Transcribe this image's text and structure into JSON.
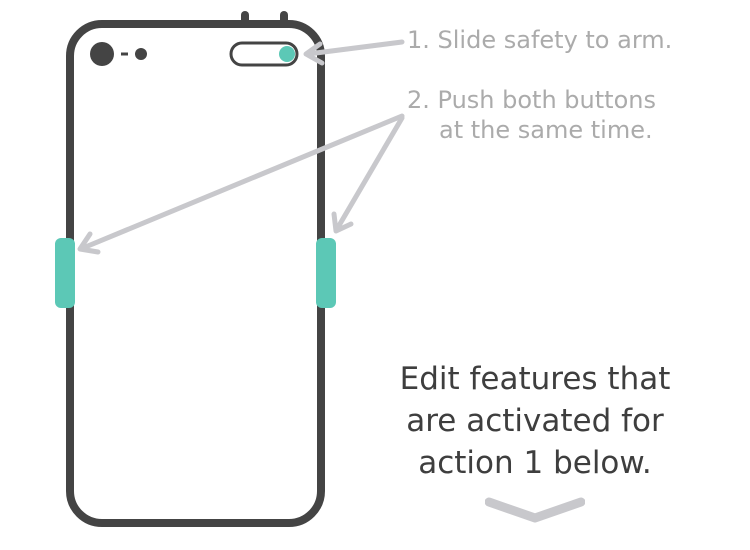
{
  "instructions": {
    "step1": "1. Slide safety to arm.",
    "step2_line1": "2. Push both buttons",
    "step2_line2": "at the same time."
  },
  "edit_note": {
    "line1": "Edit features that",
    "line2": "are activated for",
    "line3": "action 1 below."
  },
  "icons": {
    "scroll": "chevron-down-icon"
  },
  "colors": {
    "device_outline": "#444444",
    "accent": "#5cc8b6",
    "arrow": "#c8c8cc",
    "instruction_text": "#ababab",
    "note_text": "#3e3e3e"
  }
}
